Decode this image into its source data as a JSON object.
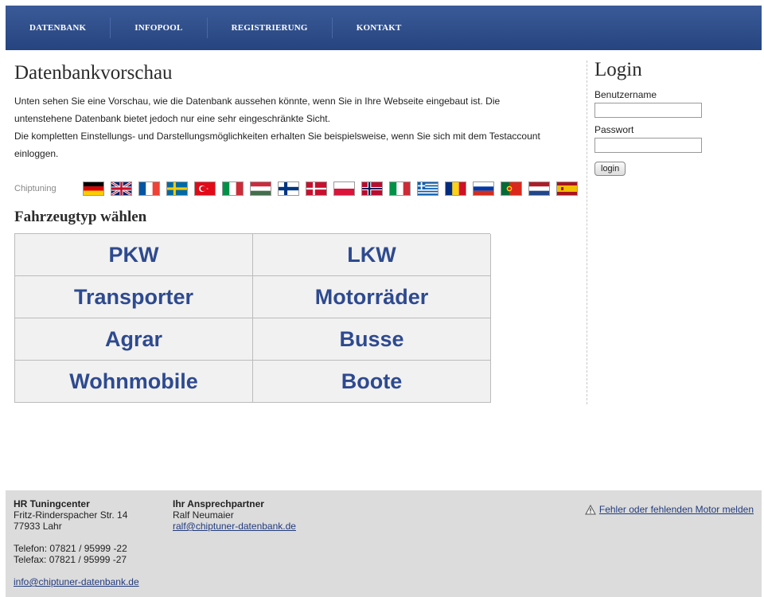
{
  "nav": {
    "items": [
      {
        "label": "DATENBANK"
      },
      {
        "label": "INFOPOOL"
      },
      {
        "label": "REGISTRIERUNG"
      },
      {
        "label": "KONTAKT"
      }
    ]
  },
  "main": {
    "title": "Datenbankvorschau",
    "intro_line1": "Unten sehen Sie eine Vorschau, wie die Datenbank aussehen könnte, wenn Sie in Ihre Webseite eingebaut ist. Die",
    "intro_line2": "untenstehene Datenbank bietet jedoch nur eine sehr eingeschränkte Sicht.",
    "intro_line3": "Die kompletten Einstellungs- und Darstellungsmöglichkeiten erhalten Sie beispielsweise, wenn Sie sich mit dem Testaccount",
    "intro_line4": "einloggen.",
    "flag_label": "Chiptuning",
    "flags": [
      "german-flag-icon",
      "uk-flag-icon",
      "french-flag-icon",
      "swedish-flag-icon",
      "turkish-flag-icon",
      "italian-flag-icon",
      "hungarian-flag-icon",
      "finnish-flag-icon",
      "danish-flag-icon",
      "polish-flag-icon",
      "norwegian-flag-icon",
      "italian-flag-icon",
      "greek-flag-icon",
      "romanian-flag-icon",
      "russian-flag-icon",
      "portuguese-flag-icon",
      "dutch-flag-icon",
      "spanish-flag-icon"
    ],
    "section_title": "Fahrzeugtyp wählen",
    "vehicle_types": [
      "PKW",
      "LKW",
      "Transporter",
      "Motorräder",
      "Agrar",
      "Busse",
      "Wohnmobile",
      "Boote"
    ]
  },
  "login": {
    "title": "Login",
    "username_label": "Benutzername",
    "password_label": "Passwort",
    "button": "login"
  },
  "footer": {
    "company": "HR Tuningcenter",
    "street": "Fritz-Rinderspacher Str. 14",
    "city": "77933 Lahr",
    "phone": "Telefon: 07821 / 95999 -22",
    "fax": "Telefax: 07821 / 95999 -27",
    "email": "info@chiptuner-datenbank.de",
    "contact_heading": "Ihr Ansprechpartner",
    "contact_name": "Ralf Neumaier",
    "contact_email": "ralf@chiptuner-datenbank.de",
    "report_link": "Fehler oder fehlenden Motor melden"
  },
  "colors": {
    "nav_bg": "#2f4f8e",
    "link": "#223b7e",
    "vehicle_text": "#2e4a8f",
    "footer_bg": "#dcdcdc"
  }
}
